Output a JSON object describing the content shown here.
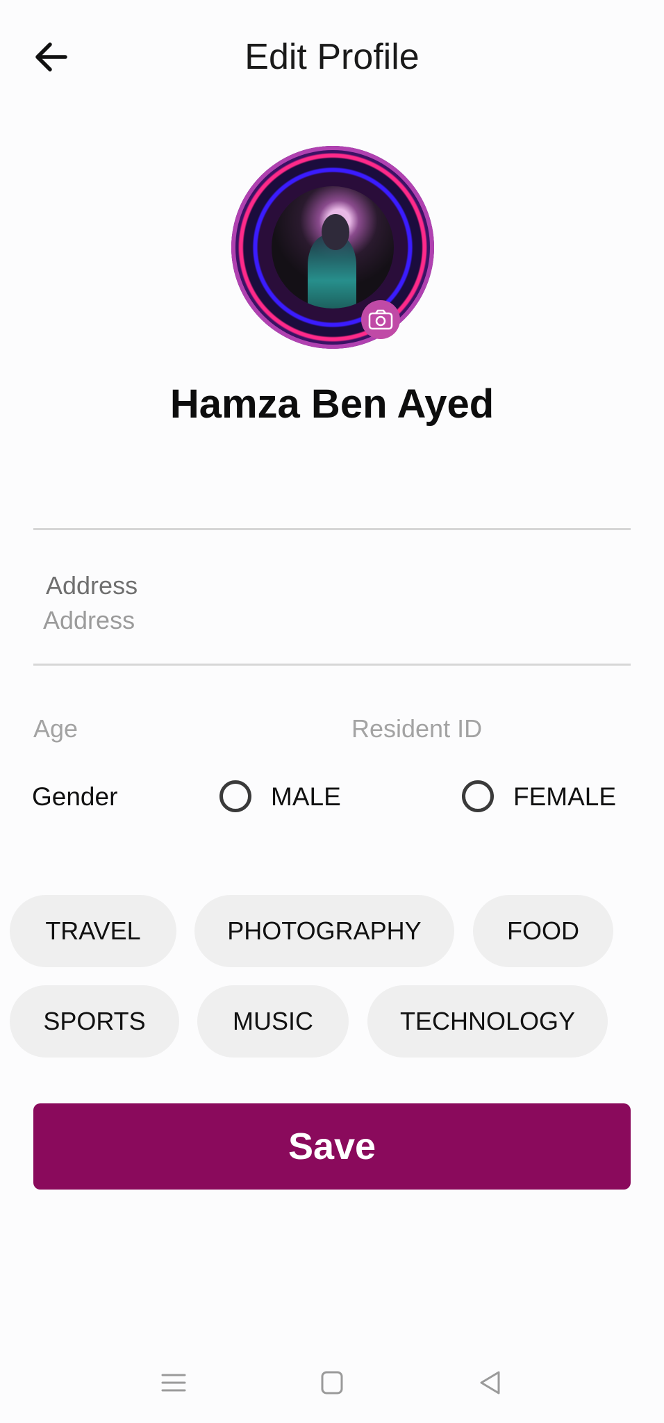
{
  "header": {
    "title": "Edit Profile",
    "back_icon": "arrow-left-icon"
  },
  "profile": {
    "name": "Hamza Ben Ayed",
    "camera_icon": "camera-icon"
  },
  "form": {
    "address": {
      "label": "Address",
      "placeholder": "Address",
      "value": ""
    },
    "age": {
      "placeholder": "Age"
    },
    "resident_id": {
      "placeholder": "Resident ID"
    },
    "gender": {
      "label": "Gender",
      "options": [
        "MALE",
        "FEMALE"
      ],
      "selected": null
    }
  },
  "interests": [
    "TRAVEL",
    "PHOTOGRAPHY",
    "FOOD",
    "SPORTS",
    "MUSIC",
    "TECHNOLOGY"
  ],
  "save_label": "Save",
  "colors": {
    "primary": "#8a0a5c",
    "chip_bg": "#efefef",
    "divider": "#d6d6d6"
  },
  "system_nav": [
    "menu-icon",
    "home-square-icon",
    "back-triangle-icon"
  ]
}
